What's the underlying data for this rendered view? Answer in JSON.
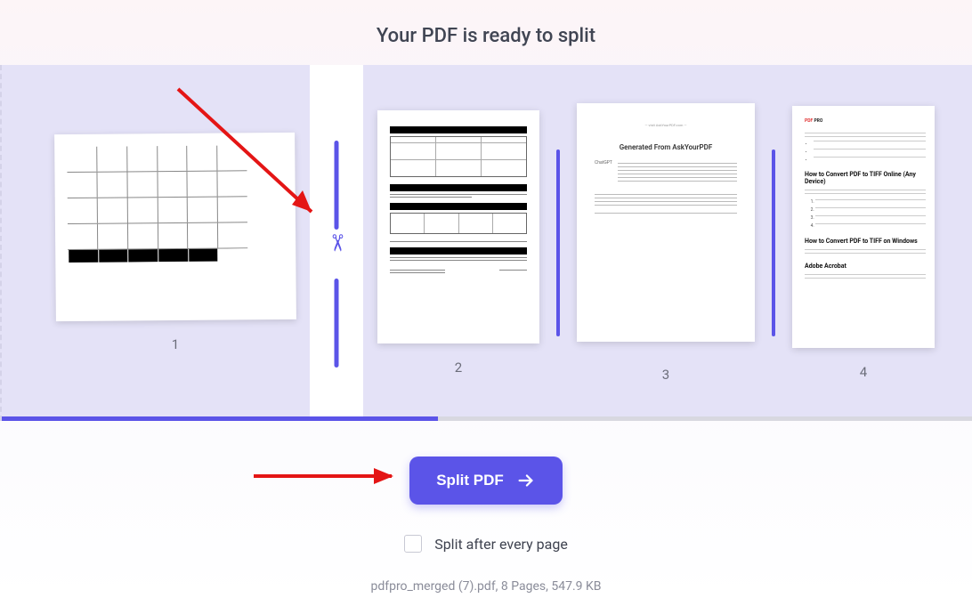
{
  "header": {
    "title": "Your PDF is ready to split"
  },
  "pages": {
    "p1": {
      "num": "1"
    },
    "p2": {
      "num": "2"
    },
    "p3": {
      "num": "3",
      "title": "Generated From AskYourPDF",
      "label": "ChatGPT"
    },
    "p4": {
      "num": "4",
      "logo_red": "PDF",
      "logo_black": " PRO",
      "h1": "How to Convert PDF to TIFF Online (Any Device)",
      "h2": "How to Convert PDF to TIFF on Windows",
      "h3": "Adobe Acrobat"
    }
  },
  "actions": {
    "split_label": "Split PDF",
    "split_every_label": "Split after every page"
  },
  "fileinfo": "pdfpro_merged (7).pdf, 8 Pages, 547.9 KB"
}
